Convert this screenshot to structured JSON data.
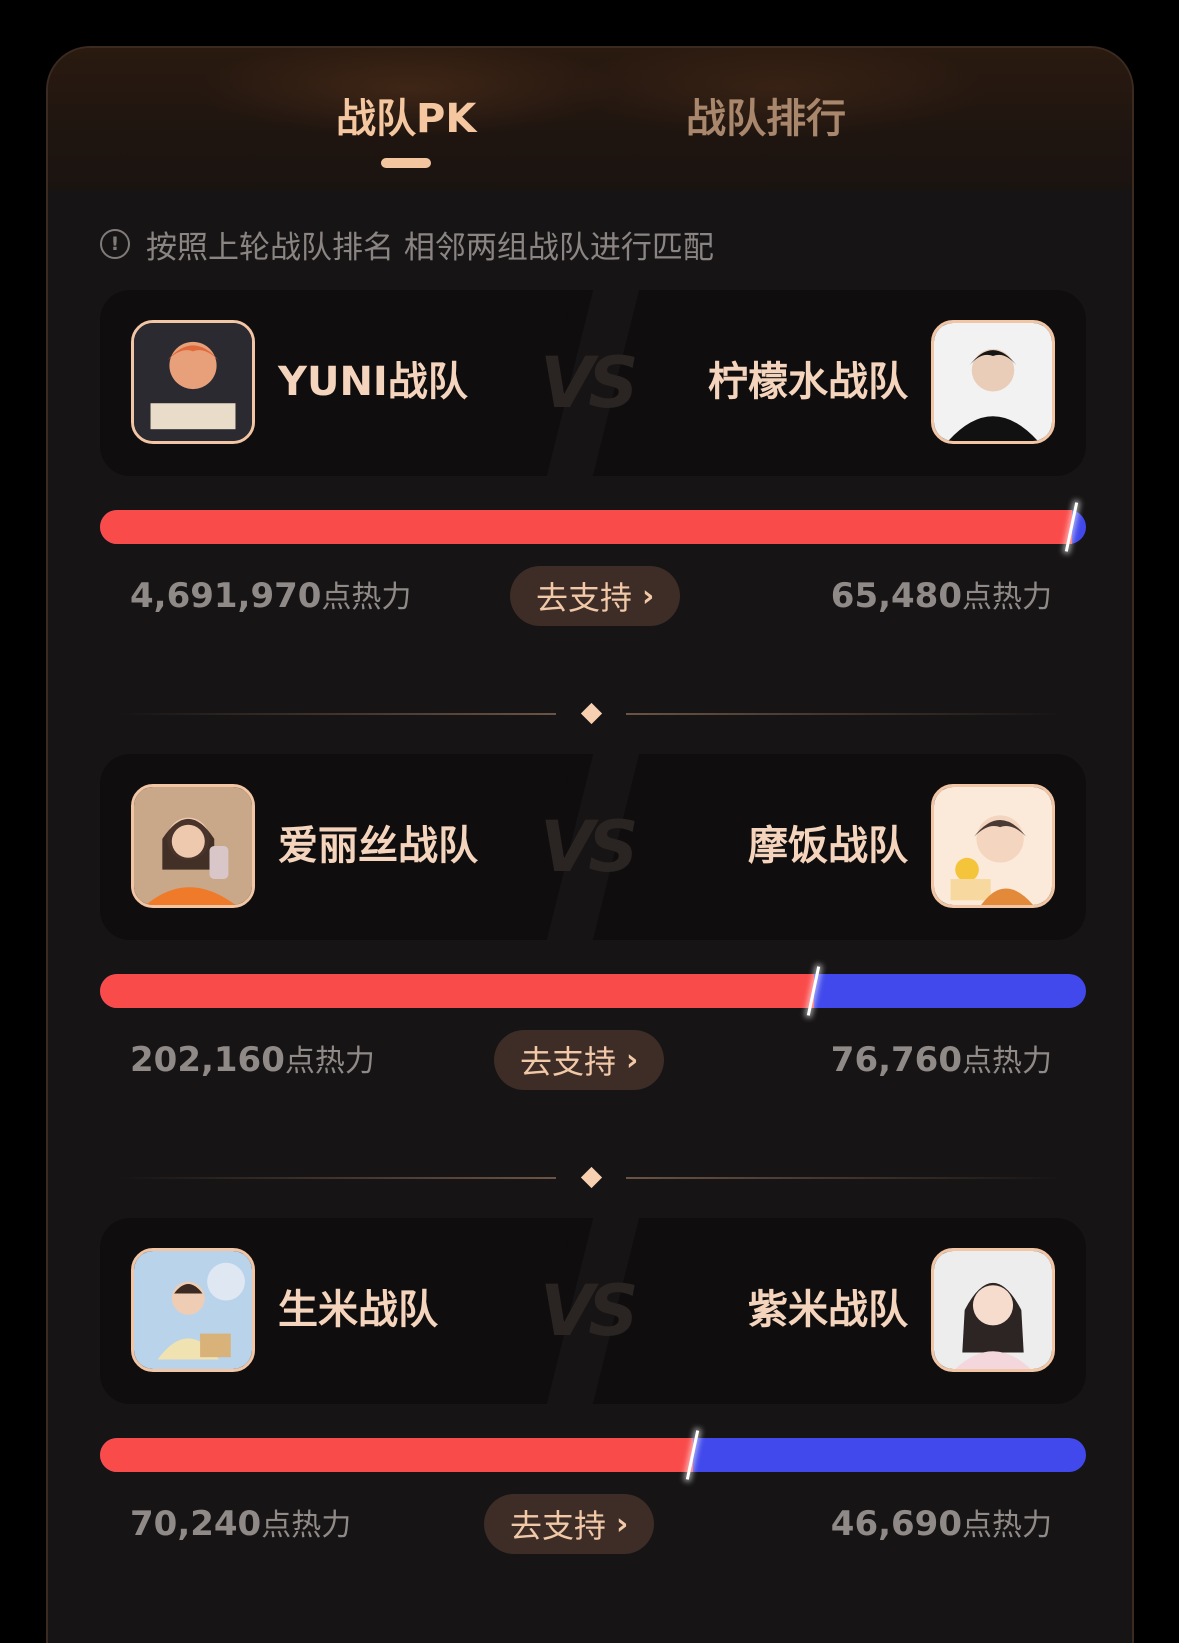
{
  "tabs": [
    {
      "label": "战队PK",
      "active": true
    },
    {
      "label": "战队排行",
      "active": false
    }
  ],
  "notice": {
    "icon": "info-icon",
    "text": "按照上轮战队排名 相邻两组战队进行匹配"
  },
  "vs_label": "VS",
  "unit": "点热力",
  "support_label": "去支持",
  "matches": [
    {
      "left": {
        "name": "YUNI战队",
        "score": "4,691,970"
      },
      "right": {
        "name": "柠檬水战队",
        "score": "65,480"
      },
      "left_share": 0.986
    },
    {
      "left": {
        "name": "爱丽丝战队",
        "score": "202,160"
      },
      "right": {
        "name": "摩饭战队",
        "score": "76,760"
      },
      "left_share": 0.724
    },
    {
      "left": {
        "name": "生米战队",
        "score": "70,240"
      },
      "right": {
        "name": "紫米战队",
        "score": "46,690"
      },
      "left_share": 0.601
    }
  ],
  "colors": {
    "accent": "#f4c7a1",
    "red": "#fa4b4b",
    "blue": "#4149ec"
  }
}
